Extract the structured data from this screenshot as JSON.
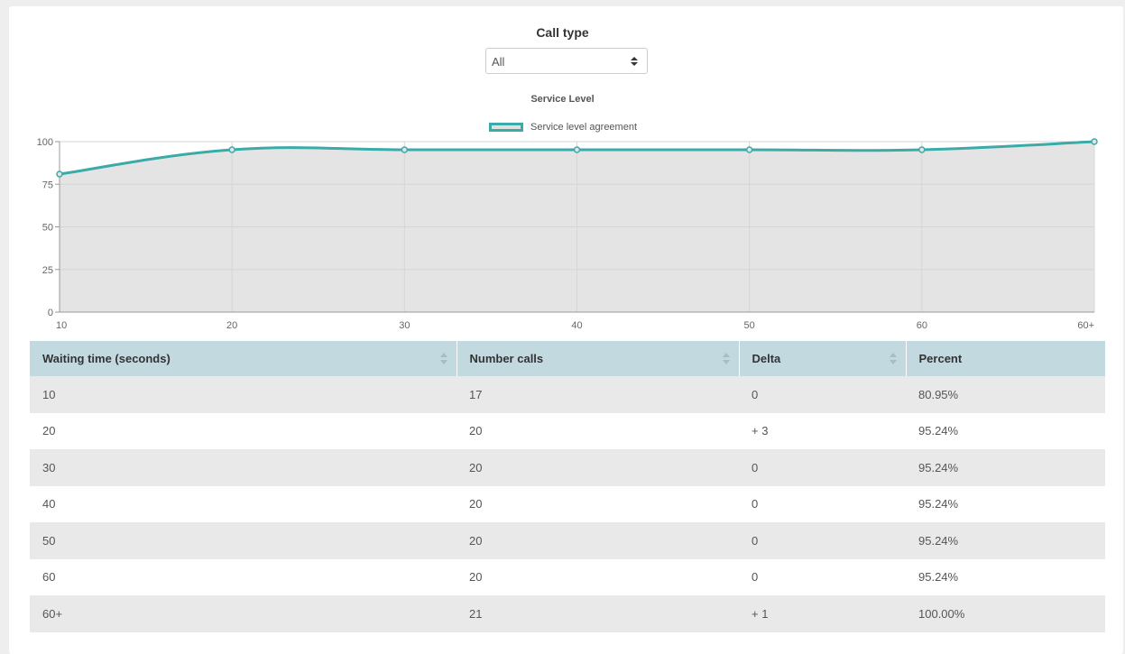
{
  "filter": {
    "label": "Call type",
    "selected": "All"
  },
  "chart_data": {
    "type": "area",
    "title": "Service Level",
    "legend": "Service level agreement",
    "legend_position": "top-center",
    "categories": [
      "10",
      "20",
      "30",
      "40",
      "50",
      "60",
      "60+"
    ],
    "series": [
      {
        "name": "Service level agreement",
        "values": [
          80.95,
          95.24,
          95.24,
          95.24,
          95.24,
          95.24,
          100
        ]
      }
    ],
    "y_ticks": [
      0,
      25,
      50,
      75,
      100
    ],
    "ylim": [
      0,
      100
    ],
    "grid": true,
    "colors": {
      "line": "#3aaba9",
      "fill": "#e4e4e4",
      "grid": "#d6d6d6"
    }
  },
  "table": {
    "headers": [
      "Waiting time (seconds)",
      "Number calls",
      "Delta",
      "Percent"
    ],
    "rows": [
      [
        "10",
        "17",
        "0",
        "80.95%"
      ],
      [
        "20",
        "20",
        "+ 3",
        "95.24%"
      ],
      [
        "30",
        "20",
        "0",
        "95.24%"
      ],
      [
        "40",
        "20",
        "0",
        "95.24%"
      ],
      [
        "50",
        "20",
        "0",
        "95.24%"
      ],
      [
        "60",
        "20",
        "0",
        "95.24%"
      ],
      [
        "60+",
        "21",
        "+ 1",
        "100.00%"
      ]
    ]
  }
}
